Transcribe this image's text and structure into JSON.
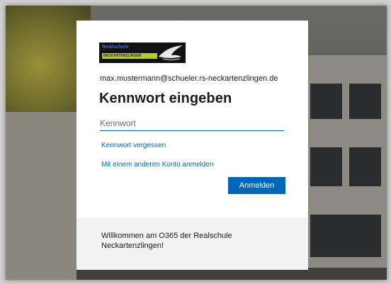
{
  "logo": {
    "line1": "Realschule",
    "line2": "NECKARTENZLINGEN",
    "colors": {
      "bg": "#111111",
      "text": "#3b6fd0",
      "bar": "#b9c63a"
    }
  },
  "account": {
    "email": "max.mustermann@schueler.rs-neckartenzlingen.de"
  },
  "page": {
    "title": "Kennwort eingeben"
  },
  "password": {
    "placeholder": "Kennwort",
    "value": ""
  },
  "links": {
    "forgot": "Kennwort vergessen",
    "other_account": "Mit einem anderen Konto anmelden"
  },
  "actions": {
    "sign_in": "Anmelden"
  },
  "footer": {
    "welcome": "Willkommen am O365 der Realschule Neckartenzlingen!"
  },
  "colors": {
    "accent": "#0067b8",
    "card_bg": "#ffffff",
    "footer_bg": "#f2f2f2"
  }
}
